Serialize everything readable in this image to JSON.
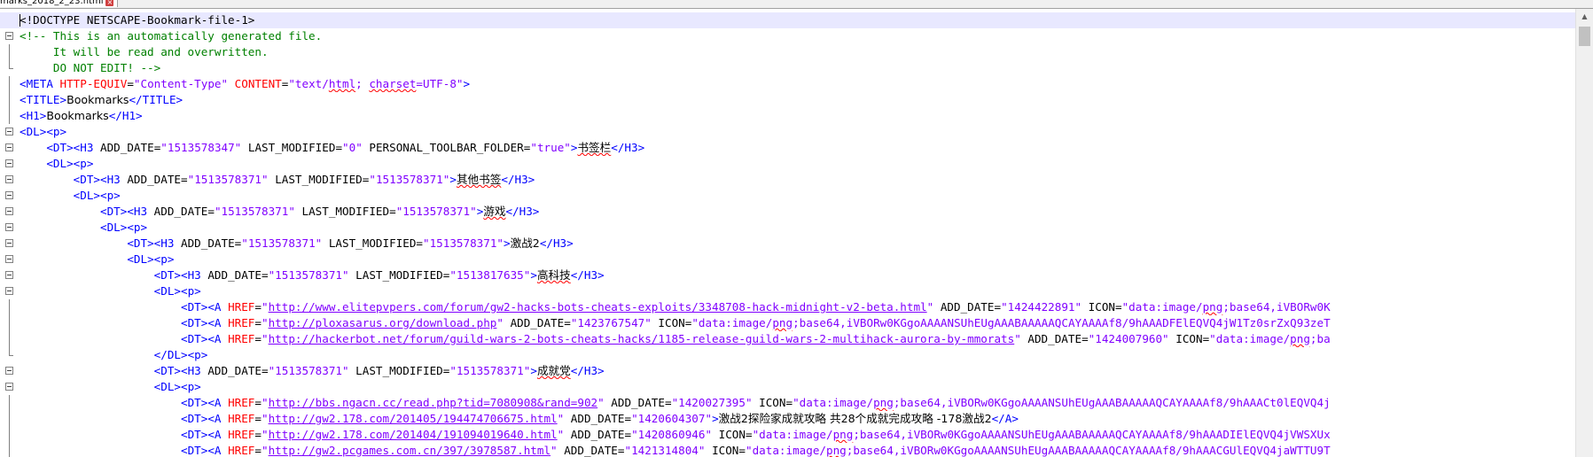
{
  "tab": {
    "filename": "marks_2018_2_23.html"
  },
  "lines": [
    [
      [
        "doctype",
        "<!DOCTYPE NETSCAPE-Bookmark-file-1>"
      ]
    ],
    [
      [
        "cmt",
        "<!-- This is an automatically generated file."
      ]
    ],
    [
      [
        "cmt",
        "     It will be read and overwritten."
      ]
    ],
    [
      [
        "cmt",
        "     DO NOT EDIT! -->"
      ]
    ],
    [
      [
        "tag",
        "<META "
      ],
      [
        "attr",
        "HTTP-EQUIV"
      ],
      [
        "ent",
        "="
      ],
      [
        "val",
        "\"Content-Type\" "
      ],
      [
        "attr",
        "CONTENT"
      ],
      [
        "ent",
        "="
      ],
      [
        "val",
        "\"text/"
      ],
      [
        "val spell",
        "html"
      ],
      [
        "val",
        "; "
      ],
      [
        "val spell",
        "charset"
      ],
      [
        "val",
        "=UTF-8\""
      ],
      [
        "tag",
        ">"
      ]
    ],
    [
      [
        "tag",
        "<TITLE>"
      ],
      [
        "text",
        "Bookmarks"
      ],
      [
        "tag",
        "</TITLE>"
      ]
    ],
    [
      [
        "tag",
        "<H1>"
      ],
      [
        "text",
        "Bookmarks"
      ],
      [
        "tag",
        "</H1>"
      ]
    ],
    [
      [
        "tag",
        "<DL><p>"
      ]
    ],
    [
      [
        "ent",
        "    "
      ],
      [
        "tag",
        "<DT><H3 "
      ],
      [
        "attr2",
        "ADD_DATE"
      ],
      [
        "ent",
        "="
      ],
      [
        "val",
        "\"1513578347\" "
      ],
      [
        "attr2",
        "LAST_MODIFIED"
      ],
      [
        "ent",
        "="
      ],
      [
        "val",
        "\"0\" "
      ],
      [
        "attr2",
        "PERSONAL_TOOLBAR_FOLDER"
      ],
      [
        "ent",
        "="
      ],
      [
        "val",
        "\"true\""
      ],
      [
        "tag",
        ">"
      ],
      [
        "text spell",
        "书签栏"
      ],
      [
        "tag",
        "</H3>"
      ]
    ],
    [
      [
        "ent",
        "    "
      ],
      [
        "tag",
        "<DL><p>"
      ]
    ],
    [
      [
        "ent",
        "        "
      ],
      [
        "tag",
        "<DT><H3 "
      ],
      [
        "attr2",
        "ADD_DATE"
      ],
      [
        "ent",
        "="
      ],
      [
        "val",
        "\"1513578371\" "
      ],
      [
        "attr2",
        "LAST_MODIFIED"
      ],
      [
        "ent",
        "="
      ],
      [
        "val",
        "\"1513578371\""
      ],
      [
        "tag",
        ">"
      ],
      [
        "text spell",
        "其他书签"
      ],
      [
        "tag",
        "</H3>"
      ]
    ],
    [
      [
        "ent",
        "        "
      ],
      [
        "tag",
        "<DL><p>"
      ]
    ],
    [
      [
        "ent",
        "            "
      ],
      [
        "tag",
        "<DT><H3 "
      ],
      [
        "attr2",
        "ADD_DATE"
      ],
      [
        "ent",
        "="
      ],
      [
        "val",
        "\"1513578371\" "
      ],
      [
        "attr2",
        "LAST_MODIFIED"
      ],
      [
        "ent",
        "="
      ],
      [
        "val",
        "\"1513578371\""
      ],
      [
        "tag",
        ">"
      ],
      [
        "text spell",
        "游戏"
      ],
      [
        "tag",
        "</H3>"
      ]
    ],
    [
      [
        "ent",
        "            "
      ],
      [
        "tag",
        "<DL><p>"
      ]
    ],
    [
      [
        "ent",
        "                "
      ],
      [
        "tag",
        "<DT><H3 "
      ],
      [
        "attr2",
        "ADD_DATE"
      ],
      [
        "ent",
        "="
      ],
      [
        "val",
        "\"1513578371\" "
      ],
      [
        "attr2",
        "LAST_MODIFIED"
      ],
      [
        "ent",
        "="
      ],
      [
        "val",
        "\"1513578371\""
      ],
      [
        "tag",
        ">"
      ],
      [
        "text",
        "激战2"
      ],
      [
        "tag",
        "</H3>"
      ]
    ],
    [
      [
        "ent",
        "                "
      ],
      [
        "tag",
        "<DL><p>"
      ]
    ],
    [
      [
        "ent",
        "                    "
      ],
      [
        "tag",
        "<DT><H3 "
      ],
      [
        "attr2",
        "ADD_DATE"
      ],
      [
        "ent",
        "="
      ],
      [
        "val",
        "\"1513578371\" "
      ],
      [
        "attr2",
        "LAST_MODIFIED"
      ],
      [
        "ent",
        "="
      ],
      [
        "val",
        "\"1513817635\""
      ],
      [
        "tag",
        ">"
      ],
      [
        "text spell",
        "高科技"
      ],
      [
        "tag",
        "</H3>"
      ]
    ],
    [
      [
        "ent",
        "                    "
      ],
      [
        "tag",
        "<DL><p>"
      ]
    ],
    [
      [
        "ent",
        "                        "
      ],
      [
        "tag",
        "<DT><A "
      ],
      [
        "attr",
        "HREF"
      ],
      [
        "ent",
        "="
      ],
      [
        "val",
        "\""
      ],
      [
        "url",
        "http://www.elitepvpers.com/forum/gw2-hacks-bots-cheats-exploits/3348708-hack-midnight-v2-beta.html"
      ],
      [
        "val",
        "\" "
      ],
      [
        "attr2",
        "ADD_DATE"
      ],
      [
        "ent",
        "="
      ],
      [
        "val",
        "\"1424422891\" "
      ],
      [
        "attr2",
        "ICON"
      ],
      [
        "ent",
        "="
      ],
      [
        "val",
        "\"data:image/"
      ],
      [
        "val spell",
        "png"
      ],
      [
        "val",
        ";base64,iVBORw0K"
      ]
    ],
    [
      [
        "ent",
        "                        "
      ],
      [
        "tag",
        "<DT><A "
      ],
      [
        "attr",
        "HREF"
      ],
      [
        "ent",
        "="
      ],
      [
        "val",
        "\""
      ],
      [
        "url",
        "http://ploxasarus.org/download.php"
      ],
      [
        "val",
        "\" "
      ],
      [
        "attr2",
        "ADD_DATE"
      ],
      [
        "ent",
        "="
      ],
      [
        "val",
        "\"1423767547\" "
      ],
      [
        "attr2",
        "ICON"
      ],
      [
        "ent",
        "="
      ],
      [
        "val",
        "\"data:image/"
      ],
      [
        "val spell",
        "png"
      ],
      [
        "val",
        ";base64,iVBORw0KGgoAAAANSUhEUgAAABAAAAAQCAYAAAAf8/9hAAADFElEQVQ4jW1Tz0srZxQ93zeT"
      ]
    ],
    [
      [
        "ent",
        "                        "
      ],
      [
        "tag",
        "<DT><A "
      ],
      [
        "attr",
        "HREF"
      ],
      [
        "ent",
        "="
      ],
      [
        "val",
        "\""
      ],
      [
        "url",
        "http://hackerbot.net/forum/guild-wars-2-bots-cheats-hacks/1185-release-guild-wars-2-multihack-aurora-by-mmorats"
      ],
      [
        "val",
        "\" "
      ],
      [
        "attr2",
        "ADD_DATE"
      ],
      [
        "ent",
        "="
      ],
      [
        "val",
        "\"1424007960\" "
      ],
      [
        "attr2",
        "ICON"
      ],
      [
        "ent",
        "="
      ],
      [
        "val",
        "\"data:image/"
      ],
      [
        "val spell",
        "png"
      ],
      [
        "val",
        ";ba"
      ]
    ],
    [
      [
        "ent",
        "                    "
      ],
      [
        "tag",
        "</DL><p>"
      ]
    ],
    [
      [
        "ent",
        "                    "
      ],
      [
        "tag",
        "<DT><H3 "
      ],
      [
        "attr2",
        "ADD_DATE"
      ],
      [
        "ent",
        "="
      ],
      [
        "val",
        "\"1513578371\" "
      ],
      [
        "attr2",
        "LAST_MODIFIED"
      ],
      [
        "ent",
        "="
      ],
      [
        "val",
        "\"1513578371\""
      ],
      [
        "tag",
        ">"
      ],
      [
        "text spell",
        "成就党"
      ],
      [
        "tag",
        "</H3>"
      ]
    ],
    [
      [
        "ent",
        "                    "
      ],
      [
        "tag",
        "<DL><p>"
      ]
    ],
    [
      [
        "ent",
        "                        "
      ],
      [
        "tag",
        "<DT><A "
      ],
      [
        "attr",
        "HREF"
      ],
      [
        "ent",
        "="
      ],
      [
        "val",
        "\""
      ],
      [
        "url",
        "http://bbs.ngacn.cc/read.php?tid=7080908&rand=902"
      ],
      [
        "val",
        "\" "
      ],
      [
        "attr2",
        "ADD_DATE"
      ],
      [
        "ent",
        "="
      ],
      [
        "val",
        "\"1420027395\" "
      ],
      [
        "attr2",
        "ICON"
      ],
      [
        "ent",
        "="
      ],
      [
        "val",
        "\"data:image/"
      ],
      [
        "val spell",
        "png"
      ],
      [
        "val",
        ";base64,iVBORw0KGgoAAAANSUhEUgAAABAAAAAQCAYAAAAf8/9hAAACt0lEQVQ4j"
      ]
    ],
    [
      [
        "ent",
        "                        "
      ],
      [
        "tag",
        "<DT><A "
      ],
      [
        "attr",
        "HREF"
      ],
      [
        "ent",
        "="
      ],
      [
        "val",
        "\""
      ],
      [
        "url",
        "http://gw2.178.com/201405/194474706675.html"
      ],
      [
        "val",
        "\" "
      ],
      [
        "attr2",
        "ADD_DATE"
      ],
      [
        "ent",
        "="
      ],
      [
        "val",
        "\"1420604307\""
      ],
      [
        "tag",
        ">"
      ],
      [
        "text",
        "激战2探险家成就攻略 共28个成就完成攻略 -178激战2"
      ],
      [
        "tag",
        "</A>"
      ]
    ],
    [
      [
        "ent",
        "                        "
      ],
      [
        "tag",
        "<DT><A "
      ],
      [
        "attr",
        "HREF"
      ],
      [
        "ent",
        "="
      ],
      [
        "val",
        "\""
      ],
      [
        "url",
        "http://gw2.178.com/201404/191094019640.html"
      ],
      [
        "val",
        "\" "
      ],
      [
        "attr2",
        "ADD_DATE"
      ],
      [
        "ent",
        "="
      ],
      [
        "val",
        "\"1420860946\" "
      ],
      [
        "attr2",
        "ICON"
      ],
      [
        "ent",
        "="
      ],
      [
        "val",
        "\"data:image/"
      ],
      [
        "val spell",
        "png"
      ],
      [
        "val",
        ";base64,iVBORw0KGgoAAAANSUhEUgAAABAAAAAQCAYAAAAf8/9hAAADIElEQVQ4jVWSXUx"
      ]
    ],
    [
      [
        "ent",
        "                        "
      ],
      [
        "tag",
        "<DT><A "
      ],
      [
        "attr",
        "HREF"
      ],
      [
        "ent",
        "="
      ],
      [
        "val",
        "\""
      ],
      [
        "url",
        "http://gw2.pcgames.com.cn/397/3978587.html"
      ],
      [
        "val",
        "\" "
      ],
      [
        "attr2",
        "ADD_DATE"
      ],
      [
        "ent",
        "="
      ],
      [
        "val",
        "\"1421314804\" "
      ],
      [
        "attr2",
        "ICON"
      ],
      [
        "ent",
        "="
      ],
      [
        "val",
        "\"data:image/"
      ],
      [
        "val spell",
        "png"
      ],
      [
        "val",
        ";base64,iVBORw0KGgoAAAANSUhEUgAAABAAAAAQCAYAAAAf8/9hAAACGUlEQVQ4jaWTTU9T"
      ]
    ]
  ]
}
